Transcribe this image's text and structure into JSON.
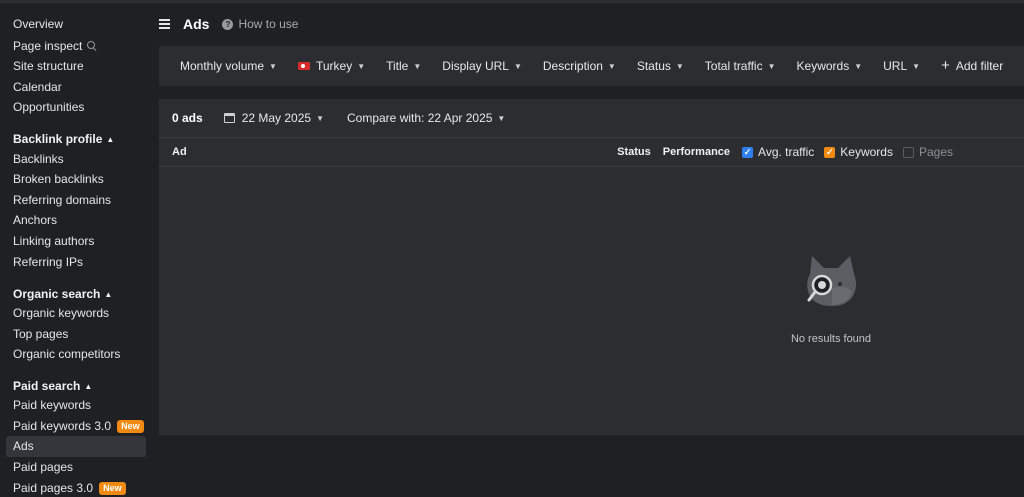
{
  "sidebar": {
    "items": [
      {
        "label": "Overview"
      },
      {
        "label": "Page inspect"
      },
      {
        "label": "Site structure"
      },
      {
        "label": "Calendar"
      },
      {
        "label": "Opportunities"
      }
    ],
    "backlink_profile": {
      "heading": "Backlink profile",
      "items": [
        "Backlinks",
        "Broken backlinks",
        "Referring domains",
        "Anchors",
        "Linking authors",
        "Referring IPs"
      ]
    },
    "organic_search": {
      "heading": "Organic search",
      "items": [
        "Organic keywords",
        "Top pages",
        "Organic competitors"
      ]
    },
    "paid_search": {
      "heading": "Paid search",
      "items": [
        "Paid keywords",
        "Paid keywords 3.0",
        "Ads",
        "Paid pages",
        "Paid pages 3.0"
      ],
      "new_badge": "New",
      "active": "Ads"
    }
  },
  "header": {
    "title": "Ads",
    "help_text": "How to use"
  },
  "filters": {
    "items": [
      "Monthly volume",
      "Turkey",
      "Title",
      "Display URL",
      "Description",
      "Status",
      "Total traffic",
      "Keywords",
      "URL"
    ],
    "add_filter": "Add filter"
  },
  "panel": {
    "ads_count": "0 ads",
    "date": "22 May 2025",
    "compare": "Compare with: 22 Apr 2025",
    "columns": {
      "ad": "Ad",
      "status": "Status",
      "performance": "Performance",
      "avg_traffic": "Avg. traffic",
      "keywords": "Keywords",
      "pages": "Pages"
    },
    "empty_message": "No results found"
  },
  "colors": {
    "background": "#1f2023",
    "panel": "#2c2d31",
    "badge": "#f08a13",
    "checkbox_blue": "#2f7ff0",
    "checkbox_orange": "#f08a13"
  }
}
